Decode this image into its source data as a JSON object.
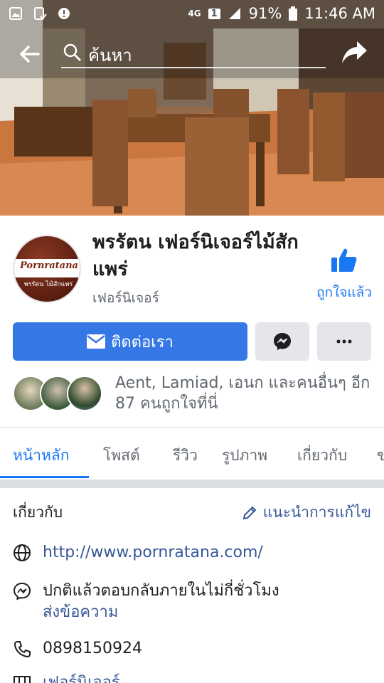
{
  "status_bar": {
    "network": "4G",
    "sim": "1",
    "battery": "91%",
    "time": "11:46 AM"
  },
  "top_bar": {
    "search_placeholder": "ค้นหา"
  },
  "page": {
    "name": "พรรัตน เฟอร์นิเจอร์ไม้สักแพร่",
    "category": "เฟอร์นิเจอร์",
    "like_label": "ถูกใจแล้ว",
    "logo_text": "Pornratana",
    "logo_subtext": "พรรัตน ไม้สักแพร่"
  },
  "actions": {
    "contact_label": "ติดต่อเรา"
  },
  "friends": {
    "text": "Aent, Lamiad, เอนก และคนอื่นๆ อีก 87 คนถูกใจที่นี่"
  },
  "tabs": [
    {
      "label": "หน้าหลัก",
      "active": true
    },
    {
      "label": "โพสต์",
      "active": false
    },
    {
      "label": "รีวิว",
      "active": false
    },
    {
      "label": "รูปภาพ",
      "active": false
    },
    {
      "label": "เกี่ยวกับ",
      "active": false
    },
    {
      "label": "ข",
      "active": false
    }
  ],
  "about": {
    "title": "เกี่ยวกับ",
    "suggest_edit": "แนะนำการแก้ไข",
    "website": "http://www.pornratana.com/",
    "response_time": "ปกติแล้วตอบกลับภายในไม่กี่ชั่วโมง",
    "send_message": "ส่งข้อความ",
    "phone": "0898150924",
    "category_row": "เฟอร์นิเจอร์"
  },
  "colors": {
    "accent": "#1877f2",
    "button_blue": "#3578e5",
    "link": "#385898",
    "muted": "#606770"
  }
}
